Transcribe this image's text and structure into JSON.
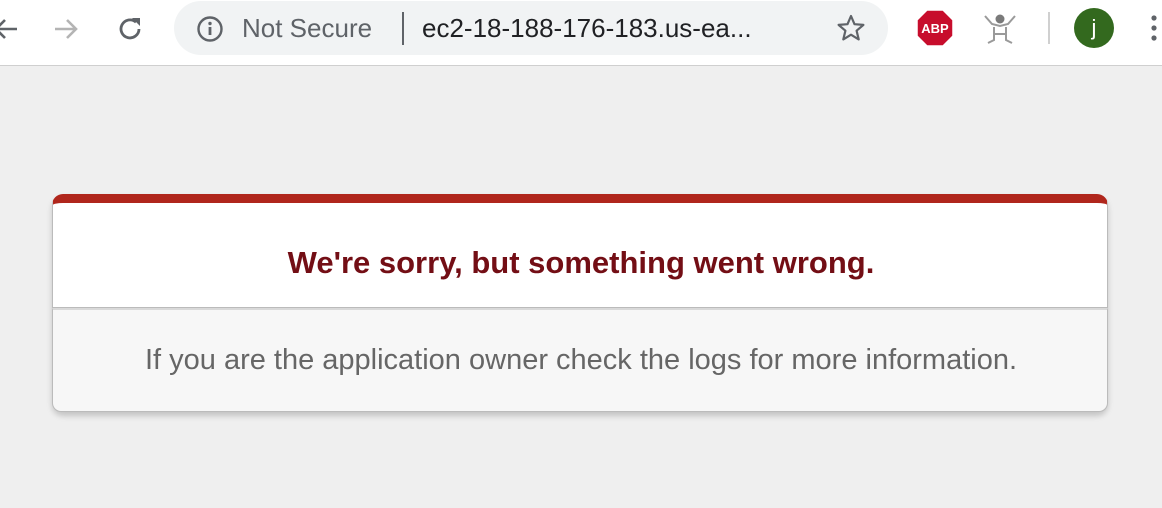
{
  "browser": {
    "security_label": "Not Secure",
    "url": "ec2-18-188-176-183.us-ea...",
    "extensions": [
      "adblock-plus",
      "reader-extension"
    ],
    "profile_initial": "j",
    "colors": {
      "profile": "#33691e",
      "abp": "#c70d2c"
    },
    "icons": [
      "back-arrow-icon",
      "forward-arrow-icon",
      "reload-icon",
      "info-icon",
      "star-icon",
      "abp-icon",
      "extension-icon",
      "kebab-menu-icon"
    ]
  },
  "error": {
    "title": "We're sorry, but something went wrong.",
    "message": "If you are the application owner check the logs for more information.",
    "colors": {
      "accent": "#b0261c",
      "title": "#730e15",
      "message": "#666666"
    }
  }
}
